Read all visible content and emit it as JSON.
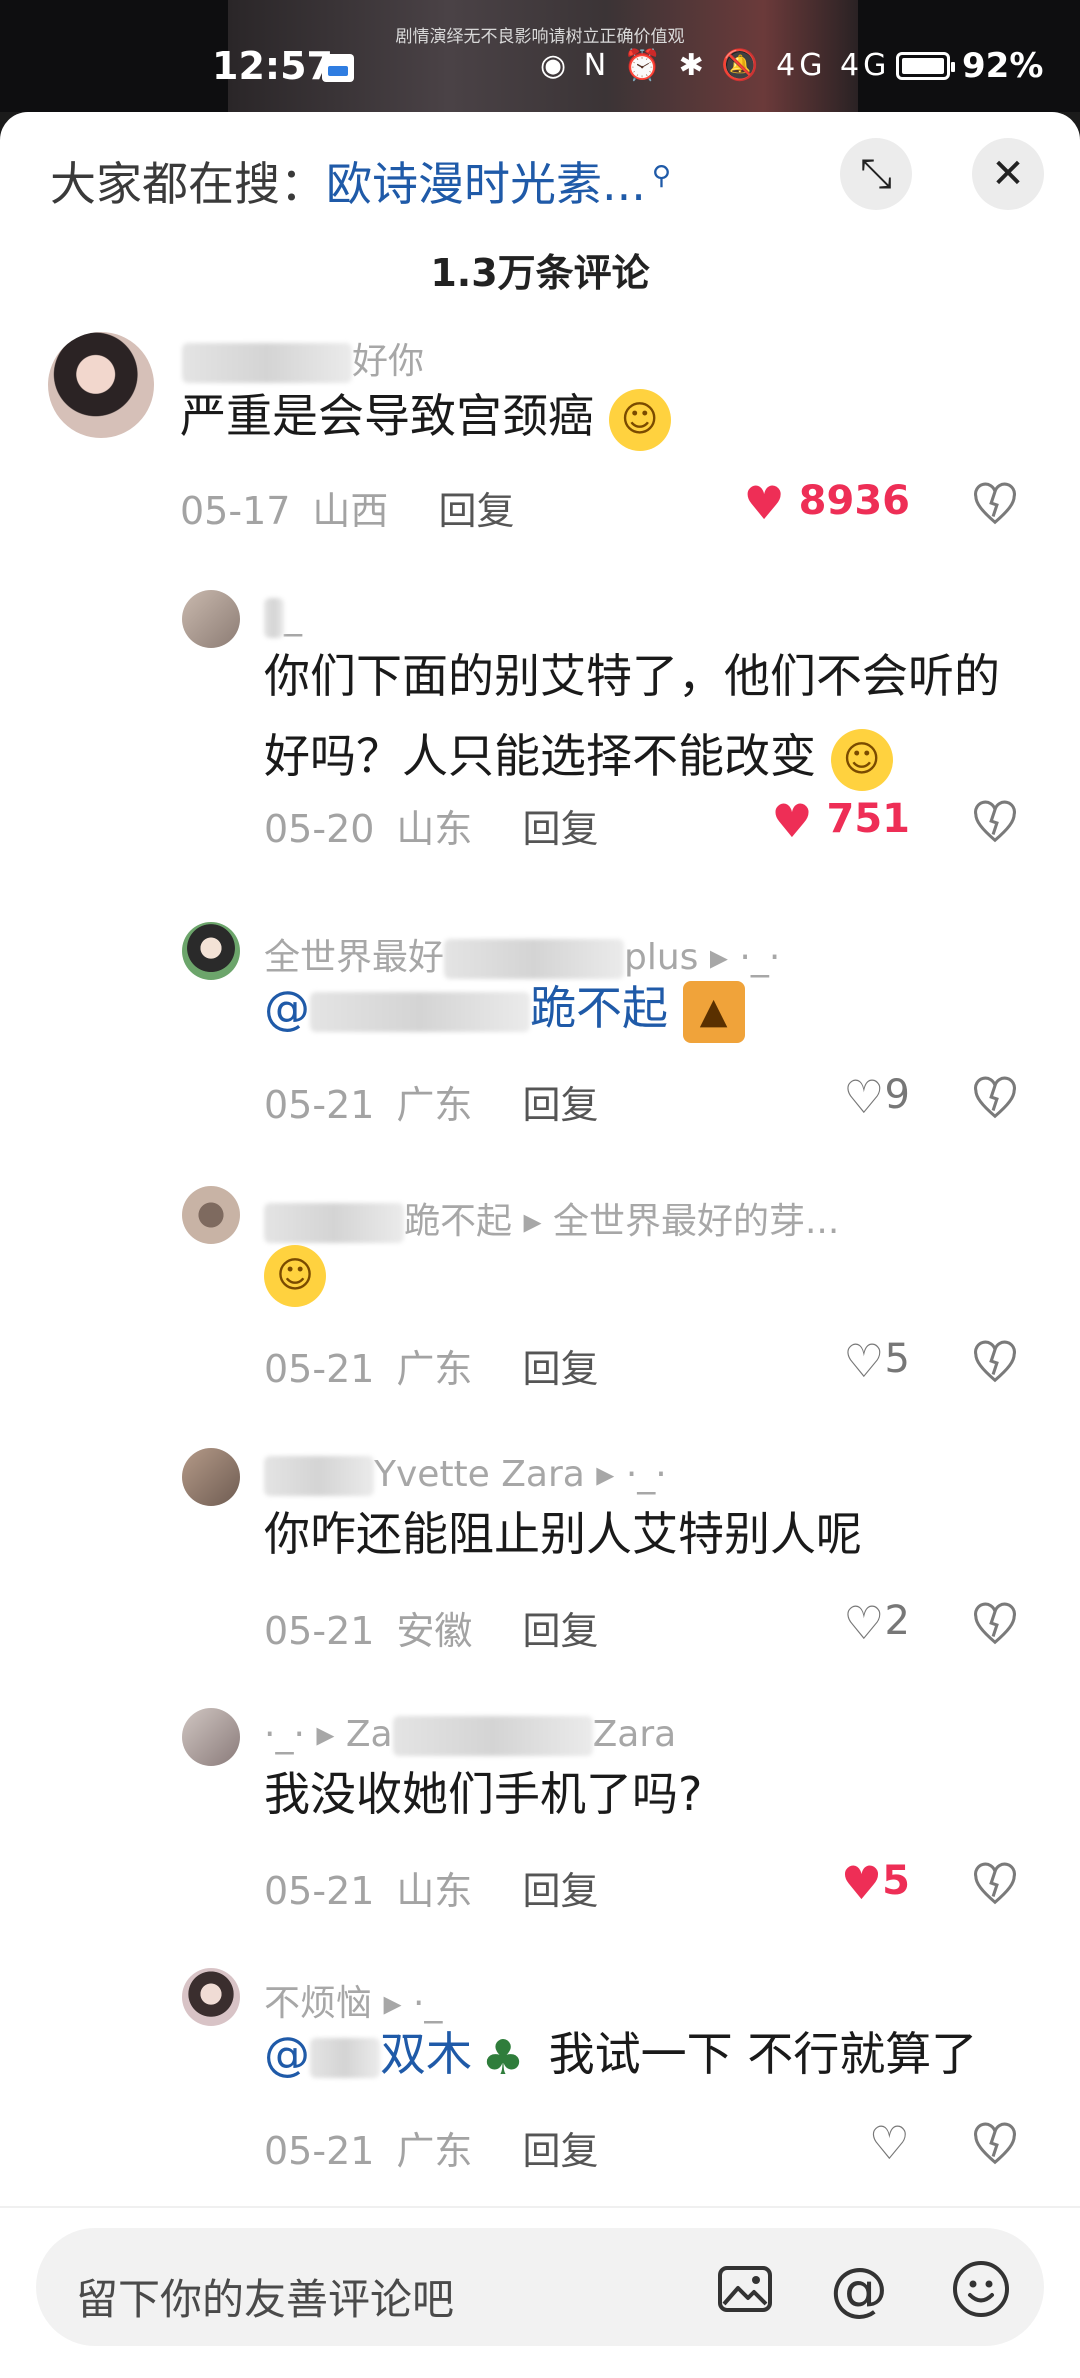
{
  "status_bar": {
    "notice": "剧情演绎无不良影响请树立正确价值观",
    "time": "12:57",
    "icons": "◉ N ⏰ ✱ 🔕 4G 4G",
    "battery_percent": "92%"
  },
  "header": {
    "search_prefix": "大家都在搜：",
    "search_keyword": "欧诗漫时光素...",
    "comment_count": "1.3万条评论"
  },
  "comments": [
    {
      "username_suffix": "好你",
      "text": "严重是会导致宫颈癌",
      "emoji": "sweat-smile",
      "date": "05-17",
      "location": "山西",
      "reply_label": "回复",
      "likes": "8936",
      "liked": true
    },
    {
      "username_suffix": "_",
      "text": "你们下面的别艾特了，他们不会听的好吗？人只能选择不能改变",
      "emoji": "flushed",
      "date": "05-20",
      "location": "山东",
      "reply_label": "回复",
      "likes": "751",
      "liked": true
    },
    {
      "username_visible": "全世界最好",
      "username_suffix": "plus",
      "reply_target": "·_·",
      "mention": "@",
      "mention_suffix": "跪不起",
      "emoji": "cat-wall",
      "date": "05-21",
      "location": "广东",
      "reply_label": "回复",
      "likes": "9",
      "liked": false
    },
    {
      "username_visible": "跪不起",
      "reply_target": "全世界最好的芽...",
      "emoji": "face-hand",
      "date": "05-21",
      "location": "广东",
      "reply_label": "回复",
      "likes": "5",
      "liked": false
    },
    {
      "username_visible": "Yvette Zara",
      "reply_target": "·_·",
      "text": "你咋还能阻止别人艾特别人呢",
      "date": "05-21",
      "location": "安徽",
      "reply_label": "回复",
      "likes": "2",
      "liked": false
    },
    {
      "username_visible": "·_·",
      "reply_target": "Za",
      "reply_target_suffix": "Zara",
      "text": "我没收她们手机了吗?",
      "date": "05-21",
      "location": "山东",
      "reply_label": "回复",
      "likes": "5",
      "liked": true
    },
    {
      "username_visible": "不烦恼",
      "reply_target": "·_",
      "mention": "@",
      "mention_suffix": "双木",
      "text": "我试一下 不行就算了",
      "emoji": "tree",
      "date": "05-21",
      "location": "广东",
      "reply_label": "回复",
      "likes": "",
      "liked": false
    }
  ],
  "bottom_bar": {
    "placeholder": "留下你的友善评论吧"
  },
  "colors": {
    "accent_blue": "#1f5aa8",
    "like_red": "#ee2e56"
  }
}
